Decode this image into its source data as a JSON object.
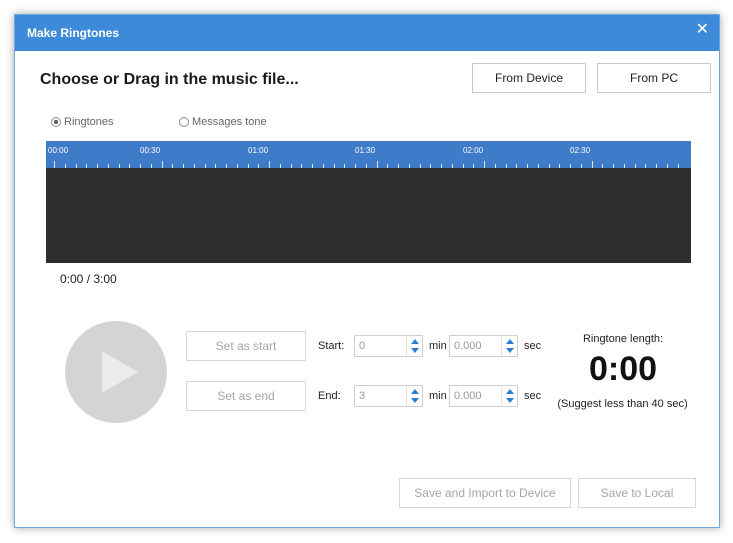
{
  "window": {
    "title": "Make Ringtones"
  },
  "header": {
    "heading": "Choose or Drag in the music file...",
    "from_device": "From Device",
    "from_pc": "From PC"
  },
  "tone_type": {
    "options": [
      {
        "label": "Ringtones",
        "selected": true
      },
      {
        "label": "Messages tone",
        "selected": false
      }
    ]
  },
  "timeline": {
    "labels": [
      "00:00",
      "00:30",
      "01:00",
      "01:30",
      "02:00",
      "02:30"
    ]
  },
  "player": {
    "time_readout": "0:00 / 3:00"
  },
  "trim": {
    "set_start_label": "Set as start",
    "set_end_label": "Set as end",
    "start_label": "Start:",
    "end_label": "End:",
    "start_min": "0",
    "start_sec": "0.000",
    "end_min": "3",
    "end_sec": "0.000",
    "min_unit": "min",
    "sec_unit": "sec"
  },
  "ringtone_length": {
    "title": "Ringtone length:",
    "value": "0:00",
    "hint": "(Suggest less than 40 sec)"
  },
  "footer": {
    "save_import": "Save and Import to Device",
    "save_local": "Save to Local"
  },
  "colors": {
    "titlebar": "#3d8ad8",
    "ruler": "#3e7bc8",
    "waveform_bg": "#2e2e2e",
    "spinner_arrow": "#2a7fd1"
  }
}
